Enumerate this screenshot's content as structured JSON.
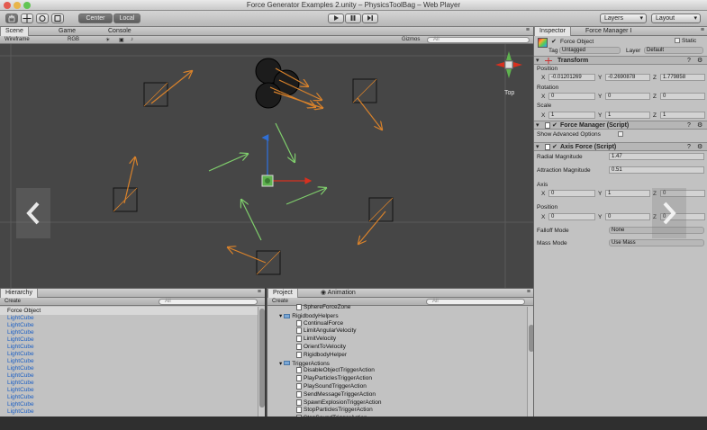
{
  "window": {
    "title": "Force Generator Examples 2.unity – PhysicsToolBag – Web Player"
  },
  "toolbar": {
    "pivot_center": "Center",
    "pivot_local": "Local",
    "layers_label": "Layers",
    "layout_label": "Layout"
  },
  "scene_panel": {
    "tabs": [
      "Scene",
      "Game",
      "Console"
    ],
    "render_mode": "Wireframe",
    "color_mode": "RGB",
    "gizmos_label": "Gizmos",
    "search_placeholder": "All",
    "view_label": "Top"
  },
  "inspector": {
    "tabs": [
      "Inspector",
      "Force Manager I"
    ],
    "object_name": "Force Object",
    "static_label": "Static",
    "tag_label": "Tag",
    "tag_value": "Untagged",
    "layer_label": "Layer",
    "layer_value": "Default",
    "transform": {
      "title": "Transform",
      "position_label": "Position",
      "position": {
        "x": "-0.01201269",
        "y": "-0.2690878",
        "z": "1.779858"
      },
      "rotation_label": "Rotation",
      "rotation": {
        "x": "0",
        "y": "0",
        "z": "0"
      },
      "scale_label": "Scale",
      "scale": {
        "x": "1",
        "y": "1",
        "z": "1"
      }
    },
    "force_manager": {
      "title": "Force Manager (Script)",
      "show_advanced": "Show Advanced Options"
    },
    "axis_force": {
      "title": "Axis Force (Script)",
      "radial_label": "Radial Magnitude",
      "radial_value": "1.47",
      "attraction_label": "Attraction Magnitude",
      "attraction_value": "0.51",
      "axis_label": "Axis",
      "axis": {
        "x": "0",
        "y": "1",
        "z": "0"
      },
      "position_label": "Position",
      "position": {
        "x": "0",
        "y": "0",
        "z": "0"
      },
      "falloff_label": "Falloff Mode",
      "falloff_value": "None",
      "mass_label": "Mass Mode",
      "mass_value": "Use Mass"
    },
    "axis_letters": {
      "x": "X",
      "y": "Y",
      "z": "Z"
    }
  },
  "hierarchy": {
    "tab": "Hierarchy",
    "create_label": "Create",
    "search_placeholder": "All",
    "items": [
      "Force Object",
      "LightCube",
      "LightCube",
      "LightCube",
      "LightCube",
      "LightCube",
      "LightCube",
      "LightCube",
      "LightCube",
      "LightCube",
      "LightCube",
      "LightCube",
      "LightCube",
      "LightCube",
      "LightCube"
    ]
  },
  "project": {
    "tabs": [
      "Project",
      "Animation"
    ],
    "create_label": "Create",
    "search_placeholder": "All",
    "items": [
      {
        "label": "SphereForceZone",
        "indent": 1,
        "kind": "file"
      },
      {
        "label": "RigidbodyHelpers",
        "indent": 0,
        "kind": "folder"
      },
      {
        "label": "ContinualForce",
        "indent": 1,
        "kind": "file"
      },
      {
        "label": "LimitAngularVelocity",
        "indent": 1,
        "kind": "file"
      },
      {
        "label": "LimitVelocity",
        "indent": 1,
        "kind": "file"
      },
      {
        "label": "OrientToVelocity",
        "indent": 1,
        "kind": "file"
      },
      {
        "label": "RigidbodyHelper",
        "indent": 1,
        "kind": "file"
      },
      {
        "label": "TriggerActions",
        "indent": 0,
        "kind": "folder"
      },
      {
        "label": "DisableObjectTriggerAction",
        "indent": 1,
        "kind": "file"
      },
      {
        "label": "PlayParticlesTriggerAction",
        "indent": 1,
        "kind": "file"
      },
      {
        "label": "PlaySoundTriggerAction",
        "indent": 1,
        "kind": "file"
      },
      {
        "label": "SendMessageTriggerAction",
        "indent": 1,
        "kind": "file"
      },
      {
        "label": "SpawnExplosionTriggerAction",
        "indent": 1,
        "kind": "file"
      },
      {
        "label": "StopParticlesTriggerAction",
        "indent": 1,
        "kind": "file"
      },
      {
        "label": "StopSoundTriggerAction",
        "indent": 1,
        "kind": "file"
      }
    ]
  },
  "colors": {
    "orange_arrow": "#d9822b",
    "green_arrow": "#7fce6c",
    "link_blue": "#1b5fc4"
  },
  "icons": {
    "prev_slide": "chevron-left-icon",
    "next_slide": "chevron-right-icon"
  }
}
